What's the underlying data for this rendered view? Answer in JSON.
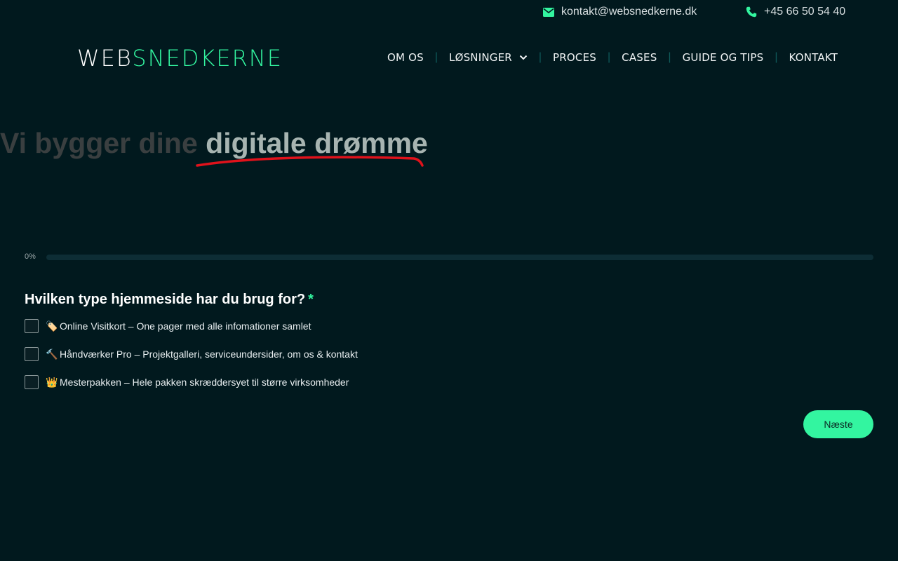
{
  "topbar": {
    "email": "kontakt@websnedkerne.dk",
    "phone": "+45 66 50 54 40"
  },
  "logo": {
    "part1": "WEB",
    "part2": "SNEDKERNE"
  },
  "nav": {
    "items": [
      "OM OS",
      "LØSNINGER",
      "PROCES",
      "CASES",
      "GUIDE OG TIPS",
      "KONTAKT"
    ]
  },
  "hero": {
    "lead": "Vi bygger dine ",
    "highlight": "digitale drømme"
  },
  "progress": {
    "label": "0%",
    "value": 0
  },
  "question": {
    "text": "Hvilken type hjemmeside har du brug for?",
    "required_mark": "*",
    "options": [
      {
        "emoji": "🏷️",
        "label": "Online Visitkort – One pager med alle infomationer samlet"
      },
      {
        "emoji": "🔨",
        "label": "Håndværker Pro – Projektgalleri, serviceundersider, om os & kontakt"
      },
      {
        "emoji": "👑",
        "label": "Mesterpakken – Hele pakken skræddersyet til større virksomheder"
      }
    ]
  },
  "next_button": "Næste",
  "colors": {
    "background": "#01191e",
    "accent": "#33f5a0",
    "underline": "#e0121b"
  }
}
